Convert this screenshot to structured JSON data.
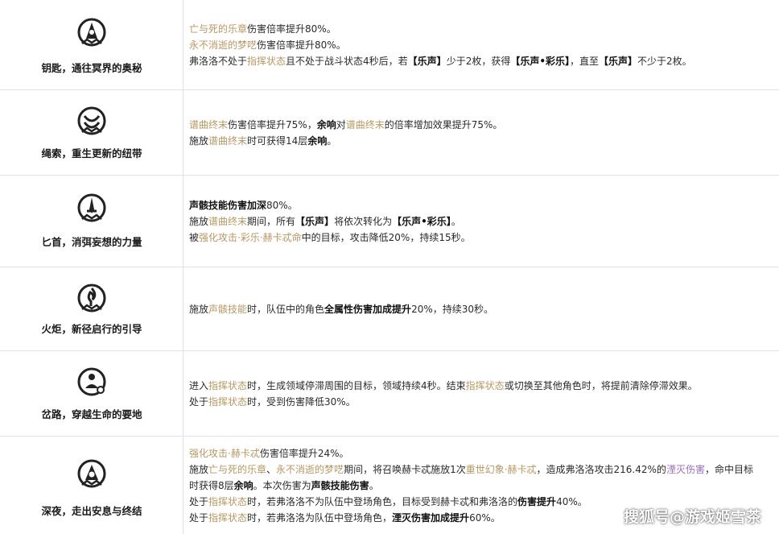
{
  "rows": [
    {
      "name": "钥匙，通往冥界的奥秘",
      "icon": "key-sigil-icon",
      "lines": [
        [
          {
            "t": "亡与死的乐章",
            "c": "gold"
          },
          {
            "t": "伤害倍率提升80%。",
            "c": ""
          }
        ],
        [
          {
            "t": "永不消逝的梦呓",
            "c": "gold"
          },
          {
            "t": "伤害倍率提升80%。",
            "c": ""
          }
        ],
        [
          {
            "t": "弗洛洛不处于",
            "c": ""
          },
          {
            "t": "指挥状态",
            "c": "gold"
          },
          {
            "t": "且不处于战斗状态4秒后，若",
            "c": ""
          },
          {
            "t": "【乐声】",
            "c": "b"
          },
          {
            "t": "少于2枚，获得",
            "c": ""
          },
          {
            "t": "【乐声•彩乐】",
            "c": "b"
          },
          {
            "t": "，直至",
            "c": ""
          },
          {
            "t": "【乐声】",
            "c": "b"
          },
          {
            "t": "不少于2枚。",
            "c": ""
          }
        ]
      ]
    },
    {
      "name": "绳索，重生更新的纽带",
      "icon": "rope-sigil-icon",
      "lines": [
        [
          {
            "t": "谱曲终末",
            "c": "gold"
          },
          {
            "t": "伤害倍率提升75%，",
            "c": ""
          },
          {
            "t": "余响",
            "c": "b"
          },
          {
            "t": "对",
            "c": ""
          },
          {
            "t": "谱曲终末",
            "c": "gold"
          },
          {
            "t": "的倍率增加效果提升75%。",
            "c": ""
          }
        ],
        [
          {
            "t": "施放",
            "c": ""
          },
          {
            "t": "谱曲终末",
            "c": "gold"
          },
          {
            "t": "时可获得14层",
            "c": ""
          },
          {
            "t": "余响",
            "c": "b"
          },
          {
            "t": "。",
            "c": ""
          }
        ]
      ]
    },
    {
      "name": "匕首，消弭妄想的力量",
      "icon": "dagger-sigil-icon",
      "lines": [
        [
          {
            "t": "声骸技能伤害加深",
            "c": "b"
          },
          {
            "t": "80%。",
            "c": ""
          }
        ],
        [
          {
            "t": "施放",
            "c": ""
          },
          {
            "t": "谱曲终末",
            "c": "gold"
          },
          {
            "t": "期间，所有",
            "c": ""
          },
          {
            "t": "【乐声】",
            "c": "b"
          },
          {
            "t": "将依次转化为",
            "c": ""
          },
          {
            "t": "【乐声•彩乐】",
            "c": "b"
          },
          {
            "t": "。",
            "c": ""
          }
        ],
        [
          {
            "t": "被",
            "c": ""
          },
          {
            "t": "强化攻击·彩乐·赫卡忒命",
            "c": "gold"
          },
          {
            "t": "中的目标，攻击降低20%，持续15秒。",
            "c": ""
          }
        ]
      ]
    },
    {
      "name": "火炬，新径启行的引导",
      "icon": "torch-sigil-icon",
      "lines": [
        [
          {
            "t": "施放",
            "c": ""
          },
          {
            "t": "声骸技能",
            "c": "gold"
          },
          {
            "t": "时，队伍中的角色",
            "c": ""
          },
          {
            "t": "全属性伤害加成提升",
            "c": "b"
          },
          {
            "t": "20%，持续30秒。",
            "c": ""
          }
        ]
      ]
    },
    {
      "name": "岔路，穿越生命的要地",
      "icon": "crossroad-sigil-icon",
      "lines": [
        [
          {
            "t": "进入",
            "c": ""
          },
          {
            "t": "指挥状态",
            "c": "gold"
          },
          {
            "t": "时，生成领域停滞周围的目标，领域持续4秒。结束",
            "c": ""
          },
          {
            "t": "指挥状态",
            "c": "gold"
          },
          {
            "t": "或切换至其他角色时，将提前清除停滞效果。",
            "c": ""
          }
        ],
        [
          {
            "t": "处于",
            "c": ""
          },
          {
            "t": "指挥状态",
            "c": "gold"
          },
          {
            "t": "时，受到伤害降低30%。",
            "c": ""
          }
        ]
      ]
    },
    {
      "name": "深夜，走出安息与终结",
      "icon": "night-sigil-icon",
      "lines": [
        [
          {
            "t": "强化攻击·赫卡忒",
            "c": "gold"
          },
          {
            "t": "伤害倍率提升24%。",
            "c": ""
          }
        ],
        [
          {
            "t": "施放",
            "c": ""
          },
          {
            "t": "亡与死的乐章",
            "c": "gold"
          },
          {
            "t": "、",
            "c": ""
          },
          {
            "t": "永不消逝的梦呓",
            "c": "gold"
          },
          {
            "t": "期间，将召唤赫卡忒施放1次",
            "c": ""
          },
          {
            "t": "重世幻象·赫卡忒",
            "c": "gold"
          },
          {
            "t": "，造成弗洛洛攻击216.42%的",
            "c": ""
          },
          {
            "t": "湮灭伤害",
            "c": "purple"
          },
          {
            "t": "，命中目标",
            "c": ""
          }
        ],
        [
          {
            "t": "时获得8层",
            "c": ""
          },
          {
            "t": "余响",
            "c": "b"
          },
          {
            "t": "。本次伤害为",
            "c": ""
          },
          {
            "t": "声骸技能伤害",
            "c": "b"
          },
          {
            "t": "。",
            "c": ""
          }
        ],
        [
          {
            "t": "处于",
            "c": ""
          },
          {
            "t": "指挥状态",
            "c": "gold"
          },
          {
            "t": "时，若弗洛洛不为队伍中登场角色，目标受到赫卡忒和弗洛洛的",
            "c": ""
          },
          {
            "t": "伤害提升",
            "c": "b"
          },
          {
            "t": "40%。",
            "c": ""
          }
        ],
        [
          {
            "t": "处于",
            "c": ""
          },
          {
            "t": "指挥状态",
            "c": "gold"
          },
          {
            "t": "时，若弗洛洛为队伍中登场角色，",
            "c": ""
          },
          {
            "t": "湮灭伤害加成提升",
            "c": "b"
          },
          {
            "t": "60%。",
            "c": ""
          }
        ]
      ]
    }
  ],
  "watermark": "搜狐号@游戏姬雪茶",
  "colors": {
    "gold": "#b59863",
    "purple": "#9b6fb8",
    "border": "#e1e1e1"
  }
}
